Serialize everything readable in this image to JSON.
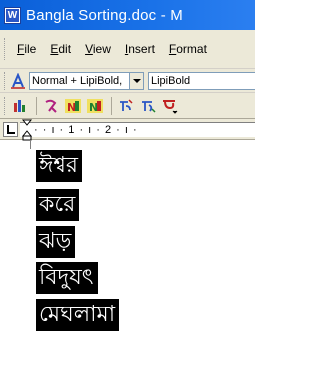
{
  "window": {
    "title": "Bangla Sorting.doc - M",
    "app_icon": "word-document-icon"
  },
  "menubar": {
    "items": [
      "File",
      "Edit",
      "View",
      "Insert",
      "Format"
    ]
  },
  "formatting_toolbar": {
    "style_value": "Normal + LipiBold,",
    "font_value": "LipiBold"
  },
  "icon_toolbar": {
    "icons": [
      "bengali-chart-icon",
      "bengali-lang-icon",
      "sort-ascending-icon",
      "sort-descending-icon",
      "bengali-convert-icon",
      "bengali-convert-2-icon",
      "bengali-letter-icon"
    ]
  },
  "ruler": {
    "text": "· · ı · 1 · ı · 2 · ı ·"
  },
  "document": {
    "lines": [
      "ঈশ্বর",
      "করে",
      "ঝড়",
      "বিদুযৎ",
      "মেঘলামা"
    ]
  },
  "colors": {
    "titlebar": "#0a5fd8",
    "chrome": "#ece9d8",
    "highlight": "#000000"
  }
}
